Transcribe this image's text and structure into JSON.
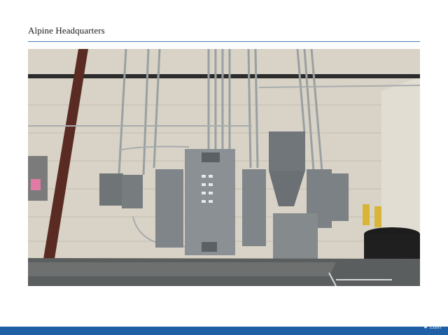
{
  "header": {
    "title": "Alpine Headquarters"
  },
  "footer": {
    "mark_text": ".com",
    "mark_icon": "logo-icon"
  },
  "colors": {
    "rule": "#4a7fb5",
    "footer_bar": "#1f5fa5"
  }
}
